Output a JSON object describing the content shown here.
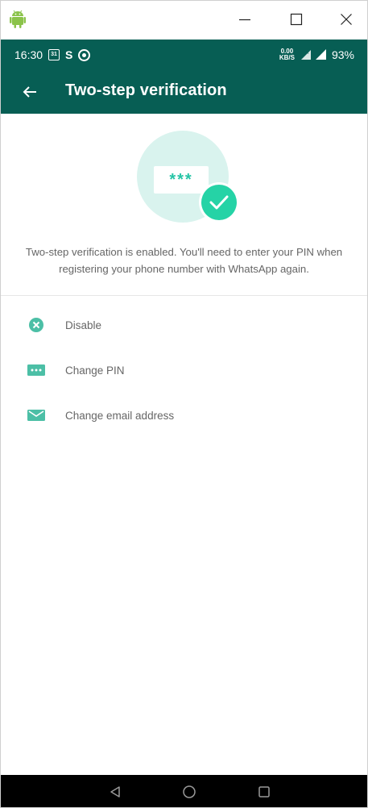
{
  "window": {
    "app_icon": "android-icon",
    "minimize_icon": "minimize-icon",
    "maximize_icon": "maximize-icon",
    "close_icon": "close-icon"
  },
  "status_bar": {
    "time": "16:30",
    "calendar_day": "31",
    "s_label": "S",
    "speed_value": "0.00",
    "speed_unit": "KB/S",
    "battery": "93%"
  },
  "app_bar": {
    "title": "Two-step verification",
    "back_icon": "arrow-left-icon"
  },
  "illustration": {
    "pin_mask": "***",
    "badge_icon": "check-icon"
  },
  "description": "Two-step verification is enabled. You'll need to enter your PIN when registering your phone number with WhatsApp again.",
  "menu": [
    {
      "label": "Disable",
      "icon": "cancel-circle-icon"
    },
    {
      "label": "Change PIN",
      "icon": "pin-dots-icon"
    },
    {
      "label": "Change email address",
      "icon": "envelope-icon"
    }
  ],
  "nav_bar": {
    "back_icon": "nav-back-icon",
    "home_icon": "nav-home-icon",
    "recent_icon": "nav-recent-icon"
  },
  "colors": {
    "primary": "#075e54",
    "accent": "#25d3a6",
    "illustration_bg": "#d9f3ee",
    "icon": "#4cbfa6"
  }
}
